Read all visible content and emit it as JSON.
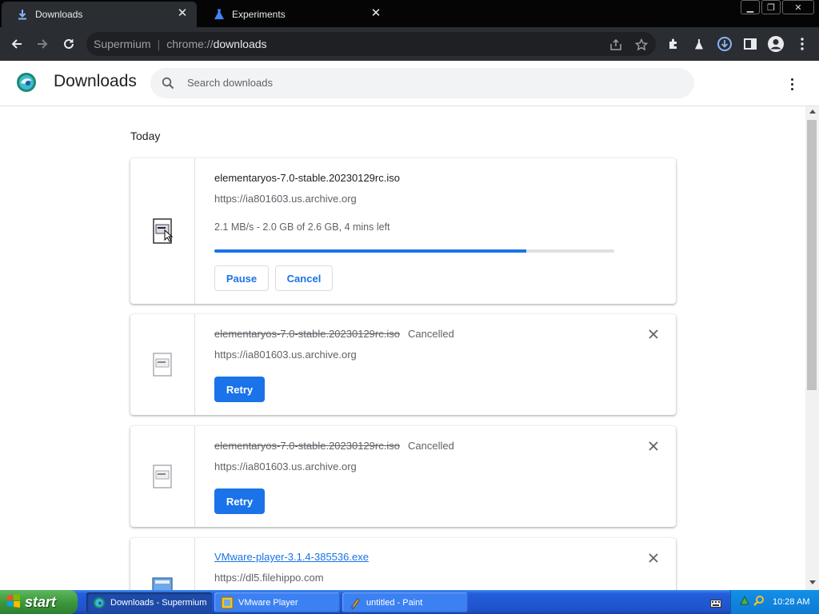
{
  "browser": {
    "tabs": [
      {
        "title": "Downloads",
        "active": true
      },
      {
        "title": "Experiments",
        "active": false
      }
    ],
    "omnibox": {
      "site": "Supermium",
      "scheme": "chrome://",
      "path": "downloads"
    }
  },
  "page": {
    "title": "Downloads",
    "search_placeholder": "Search downloads",
    "date_label": "Today"
  },
  "downloads": [
    {
      "filename": "elementaryos-7.0-stable.20230129rc.iso",
      "url": "https://ia801603.us.archive.org",
      "progress_text": "2.1 MB/s - 2.0 GB of 2.6 GB, 4 mins left",
      "progress_fraction": 0.78,
      "pause_label": "Pause",
      "cancel_label": "Cancel"
    },
    {
      "filename": "elementaryos-7.0-stable.20230129rc.iso",
      "status": "Cancelled",
      "url": "https://ia801603.us.archive.org",
      "retry_label": "Retry"
    },
    {
      "filename": "elementaryos-7.0-stable.20230129rc.iso",
      "status": "Cancelled",
      "url": "https://ia801603.us.archive.org",
      "retry_label": "Retry"
    },
    {
      "filename": "VMware-player-3.1.4-385536.exe",
      "url": "https://dl5.filehippo.com"
    }
  ],
  "taskbar": {
    "start_label": "start",
    "tasks": [
      {
        "label": "Downloads - Supermium",
        "active": true
      },
      {
        "label": "VMware Player",
        "active": false
      },
      {
        "label": "untitled - Paint",
        "active": false
      }
    ],
    "clock": "10:28 AM"
  },
  "colors": {
    "accent": "#1a73e8",
    "tab_strip": "#050505",
    "toolbar": "#2a2d32",
    "taskbar": "#245edb",
    "start_button": "#3c9a3c"
  }
}
